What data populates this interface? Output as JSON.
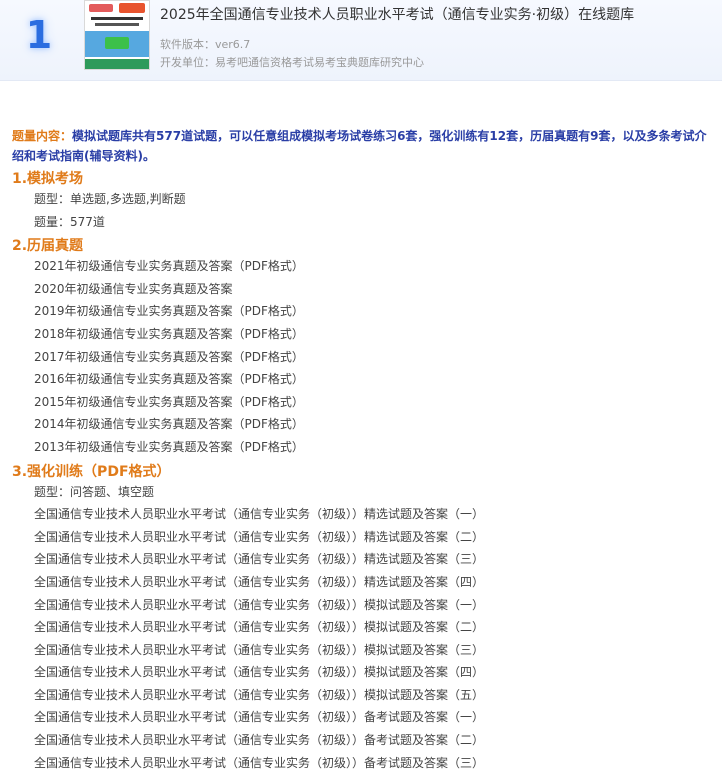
{
  "header": {
    "rank": "1",
    "title": "2025年全国通信专业技术人员职业水平考试（通信专业实务·初级）在线题库",
    "version": "软件版本：ver6.7",
    "developer": "开发单位：易考吧通信资格考试易考宝典题库研究中心"
  },
  "intro": {
    "label": "题量内容：",
    "text": "模拟试题库共有577道试题，可以任意组成模拟考场试卷练习6套，强化训练有12套，历届真题有9套，以及多条考试介绍和考试指南(辅导资料)。"
  },
  "sections": [
    {
      "title": "1.模拟考场",
      "items": [
        "题型：单选题,多选题,判断题",
        "题量：577道"
      ]
    },
    {
      "title": "2.历届真题",
      "items": [
        "2021年初级通信专业实务真题及答案（PDF格式）",
        "2020年初级通信专业实务真题及答案",
        "2019年初级通信专业实务真题及答案（PDF格式）",
        "2018年初级通信专业实务真题及答案（PDF格式）",
        "2017年初级通信专业实务真题及答案（PDF格式）",
        "2016年初级通信专业实务真题及答案（PDF格式）",
        "2015年初级通信专业实务真题及答案（PDF格式）",
        "2014年初级通信专业实务真题及答案（PDF格式）",
        "2013年初级通信专业实务真题及答案（PDF格式）"
      ]
    },
    {
      "title": "3.强化训练（PDF格式）",
      "items": [
        "题型：问答题、填空题",
        "全国通信专业技术人员职业水平考试（通信专业实务（初级））精选试题及答案（一）",
        "全国通信专业技术人员职业水平考试（通信专业实务（初级））精选试题及答案（二）",
        "全国通信专业技术人员职业水平考试（通信专业实务（初级））精选试题及答案（三）",
        "全国通信专业技术人员职业水平考试（通信专业实务（初级））精选试题及答案（四）",
        "全国通信专业技术人员职业水平考试（通信专业实务（初级））模拟试题及答案（一）",
        "全国通信专业技术人员职业水平考试（通信专业实务（初级））模拟试题及答案（二）",
        "全国通信专业技术人员职业水平考试（通信专业实务（初级））模拟试题及答案（三）",
        "全国通信专业技术人员职业水平考试（通信专业实务（初级））模拟试题及答案（四）",
        "全国通信专业技术人员职业水平考试（通信专业实务（初级））模拟试题及答案（五）",
        "全国通信专业技术人员职业水平考试（通信专业实务（初级））备考试题及答案（一）",
        "全国通信专业技术人员职业水平考试（通信专业实务（初级））备考试题及答案（二）",
        "全国通信专业技术人员职业水平考试（通信专业实务（初级））备考试题及答案（三）"
      ]
    }
  ]
}
